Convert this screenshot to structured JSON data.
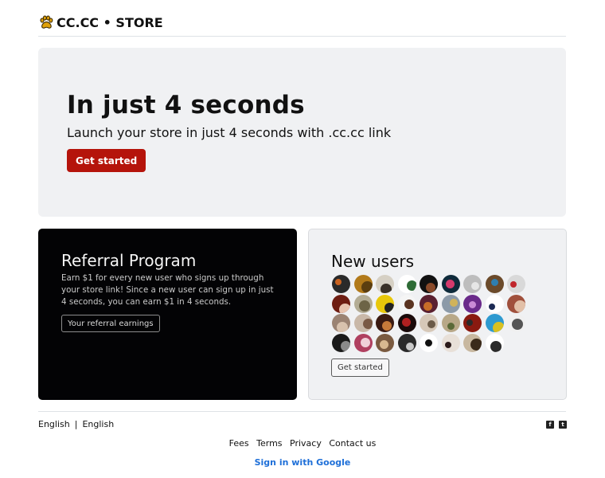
{
  "header": {
    "brand": "CC.CC • STORE",
    "logo_icon": "paw-icon"
  },
  "hero": {
    "title": "In just 4 seconds",
    "subtitle": "Launch your store in just 4 seconds with .cc.cc link",
    "cta_label": "Get started",
    "cta_color": "#b5140b"
  },
  "referral": {
    "title": "Referral Program",
    "description": "Earn $1 for every new user who signs up through your store link! Since a new user can sign up in just 4 seconds, you can earn $1 in 4 seconds.",
    "button_label": "Your referral earnings"
  },
  "new_users": {
    "title": "New users",
    "button_label": "Get started",
    "avatars": [
      {
        "bg": "#2a2a2a",
        "fg": "#c9621f"
      },
      {
        "bg": "#b27a1a",
        "fg": "#5b3e0f"
      },
      {
        "bg": "#d6d0c4",
        "fg": "#3a3128"
      },
      {
        "bg": "#ffffff",
        "fg": "#2e6b36"
      },
      {
        "bg": "#111111",
        "fg": "#8a4a2a"
      },
      {
        "bg": "#0e2a3a",
        "fg": "#d43a6c"
      },
      {
        "bg": "#bdbdbd",
        "fg": "#e6e6e6"
      },
      {
        "bg": "#6b4a2a",
        "fg": "#2e7fb0"
      },
      {
        "bg": "#d9d9d9",
        "fg": "#c0262c"
      },
      {
        "bg": "#6e1d12",
        "fg": "#e8c4b0"
      },
      {
        "bg": "#b3ac94",
        "fg": "#6d6446"
      },
      {
        "bg": "#e8c70a",
        "fg": "#222222"
      },
      {
        "bg": "#f5f5f5",
        "fg": "#5a3320"
      },
      {
        "bg": "#5a2030",
        "fg": "#c76d28"
      },
      {
        "bg": "#8c9aa8",
        "fg": "#d1b35a"
      },
      {
        "bg": "#6a2a8a",
        "fg": "#c98ad6"
      },
      {
        "bg": "#ffffff",
        "fg": "#1c2a54"
      },
      {
        "bg": "#a0503c",
        "fg": "#e2c0a8"
      },
      {
        "bg": "#9b8373",
        "fg": "#d8c2ae"
      },
      {
        "bg": "#c9b8a8",
        "fg": "#7a5a45"
      },
      {
        "bg": "#3a1a12",
        "fg": "#c77a3a"
      },
      {
        "bg": "#1a0a0a",
        "fg": "#b02020"
      },
      {
        "bg": "#d6c8b8",
        "fg": "#6a5a48"
      },
      {
        "bg": "#b8a888",
        "fg": "#5a6a38"
      },
      {
        "bg": "#8a1a10",
        "fg": "#2a2a2a"
      },
      {
        "bg": "#2e9ad0",
        "fg": "#d8c020"
      },
      {
        "bg": "#f0f0f0",
        "fg": "#555555"
      },
      {
        "bg": "#1a1a1a",
        "fg": "#8a8a8a"
      },
      {
        "bg": "#b04060",
        "fg": "#f0d0d8"
      },
      {
        "bg": "#7a5a40",
        "fg": "#d8b890"
      },
      {
        "bg": "#2a2a2a",
        "fg": "#c8c8c8"
      },
      {
        "bg": "#ffffff",
        "fg": "#111111"
      },
      {
        "bg": "#e8e0d8",
        "fg": "#2a1a1a"
      },
      {
        "bg": "#c8b8a0",
        "fg": "#3a2a1a"
      },
      {
        "bg": "#ffffff",
        "fg": "#2a2a2a"
      }
    ]
  },
  "footer": {
    "lang_current": "English",
    "lang_separator": "|",
    "lang_option": "English",
    "links": [
      "Fees",
      "Terms",
      "Privacy",
      "Contact us"
    ],
    "signin_label": "Sign in with Google",
    "signin_color": "#1e6fd8",
    "social_icons": [
      "facebook-icon",
      "twitter-icon"
    ]
  }
}
